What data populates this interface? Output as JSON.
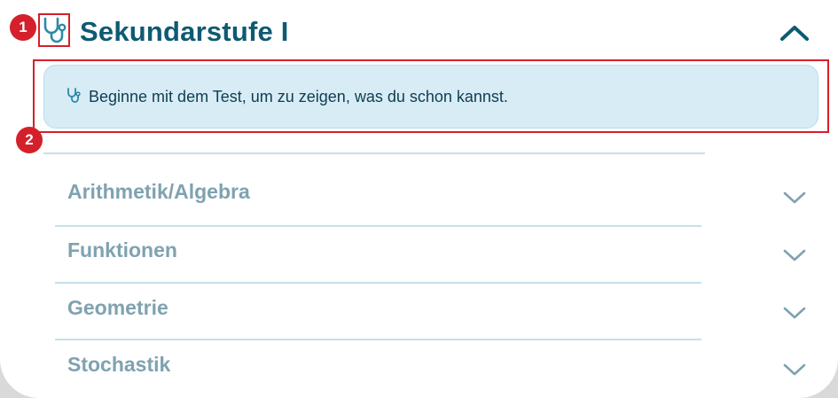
{
  "header": {
    "title": "Sekundarstufe I",
    "icon": "stethoscope-icon",
    "collapse_icon": "chevron-up-icon"
  },
  "annotations": {
    "marker_1": "1",
    "marker_2": "2"
  },
  "hint": {
    "icon": "stethoscope-icon",
    "text": "Beginne mit dem Test, um zu zeigen, was du schon kannst."
  },
  "topics": [
    {
      "label": "Arithmetik/Algebra",
      "icon": "chevron-down-icon"
    },
    {
      "label": "Funktionen",
      "icon": "chevron-down-icon"
    },
    {
      "label": "Geometrie",
      "icon": "chevron-down-icon"
    },
    {
      "label": "Stochastik",
      "icon": "chevron-down-icon"
    }
  ],
  "colors": {
    "title": "#0e5a73",
    "accent_teal": "#2d8aa8",
    "hint_background": "#d8ecf5",
    "hint_text": "#0e3d52",
    "topic_text": "#7fa2b0",
    "divider": "#c6e0ea",
    "annotation_red": "#d4202b"
  }
}
